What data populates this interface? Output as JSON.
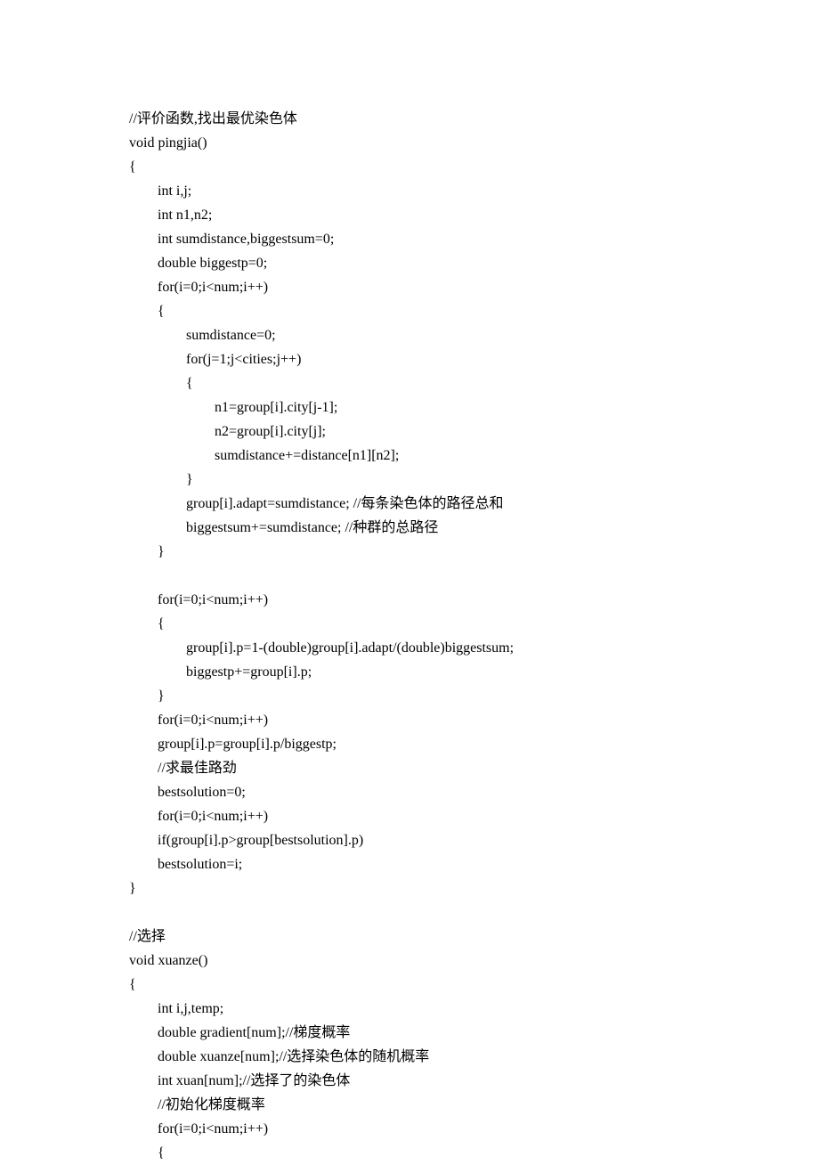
{
  "lines": [
    "//评价函数,找出最优染色体",
    "void pingjia()",
    "{",
    "        int i,j;",
    "        int n1,n2;",
    "        int sumdistance,biggestsum=0;",
    "        double biggestp=0;",
    "        for(i=0;i<num;i++)",
    "        {",
    "                sumdistance=0;",
    "                for(j=1;j<cities;j++)",
    "                {",
    "                        n1=group[i].city[j-1];",
    "                        n2=group[i].city[j];",
    "                        sumdistance+=distance[n1][n2];",
    "                }",
    "                group[i].adapt=sumdistance; //每条染色体的路径总和",
    "                biggestsum+=sumdistance; //种群的总路径",
    "        }",
    "",
    "        for(i=0;i<num;i++)",
    "        {",
    "                group[i].p=1-(double)group[i].adapt/(double)biggestsum;",
    "                biggestp+=group[i].p;",
    "        }",
    "        for(i=0;i<num;i++)",
    "        group[i].p=group[i].p/biggestp;",
    "        //求最佳路劲",
    "        bestsolution=0;",
    "        for(i=0;i<num;i++)",
    "        if(group[i].p>group[bestsolution].p)",
    "        bestsolution=i;",
    "}",
    "",
    "//选择",
    "void xuanze()",
    "{",
    "        int i,j,temp;",
    "        double gradient[num];//梯度概率",
    "        double xuanze[num];//选择染色体的随机概率",
    "        int xuan[num];//选择了的染色体",
    "        //初始化梯度概率",
    "        for(i=0;i<num;i++)",
    "        {"
  ]
}
